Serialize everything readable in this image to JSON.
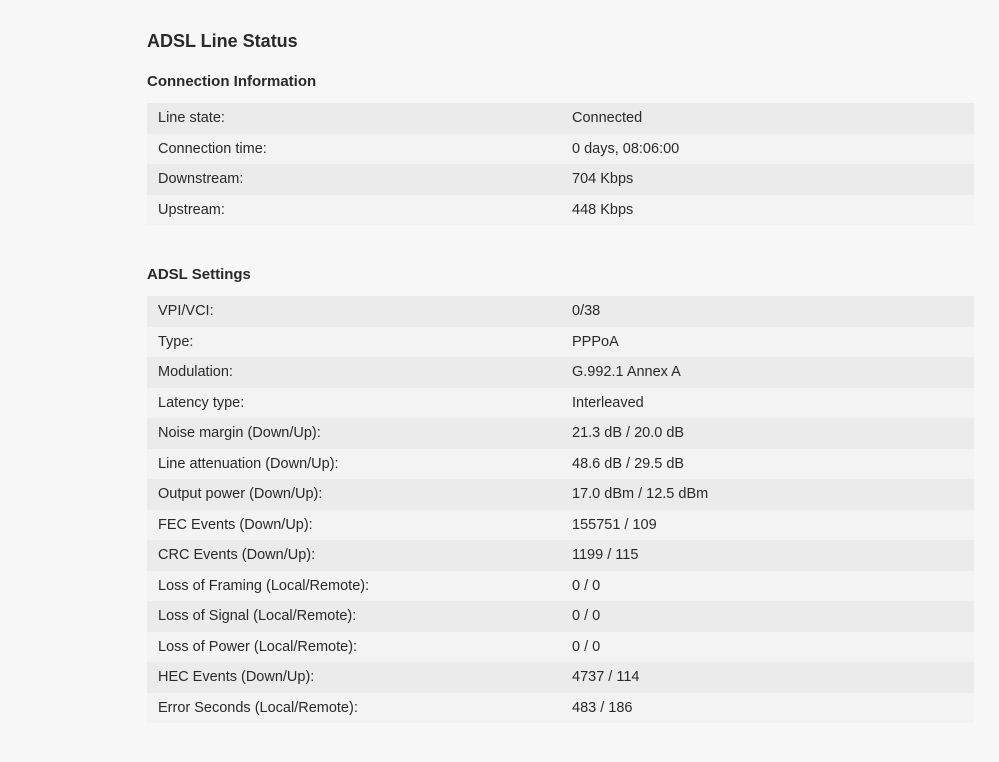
{
  "page": {
    "title": "ADSL Line Status"
  },
  "connection": {
    "heading": "Connection Information",
    "rows": [
      {
        "label": "Line state:",
        "value": "Connected"
      },
      {
        "label": "Connection time:",
        "value": "0 days, 08:06:00"
      },
      {
        "label": "Downstream:",
        "value": "704 Kbps"
      },
      {
        "label": "Upstream:",
        "value": "448 Kbps"
      }
    ]
  },
  "adsl": {
    "heading": "ADSL Settings",
    "rows": [
      {
        "label": "VPI/VCI:",
        "value": "0/38"
      },
      {
        "label": "Type:",
        "value": "PPPoA"
      },
      {
        "label": "Modulation:",
        "value": "G.992.1 Annex A"
      },
      {
        "label": "Latency type:",
        "value": "Interleaved"
      },
      {
        "label": "Noise margin (Down/Up):",
        "value": "21.3 dB / 20.0 dB"
      },
      {
        "label": "Line attenuation (Down/Up):",
        "value": "48.6 dB / 29.5 dB"
      },
      {
        "label": "Output power (Down/Up):",
        "value": "17.0 dBm / 12.5 dBm"
      },
      {
        "label": "FEC Events (Down/Up):",
        "value": "155751 / 109"
      },
      {
        "label": "CRC Events (Down/Up):",
        "value": "1199 / 115"
      },
      {
        "label": "Loss of Framing (Local/Remote):",
        "value": "0 / 0"
      },
      {
        "label": "Loss of Signal (Local/Remote):",
        "value": "0 / 0"
      },
      {
        "label": "Loss of Power (Local/Remote):",
        "value": "0 / 0"
      },
      {
        "label": "HEC Events (Down/Up):",
        "value": "4737 / 114"
      },
      {
        "label": "Error Seconds (Local/Remote):",
        "value": "483 / 186"
      }
    ]
  }
}
